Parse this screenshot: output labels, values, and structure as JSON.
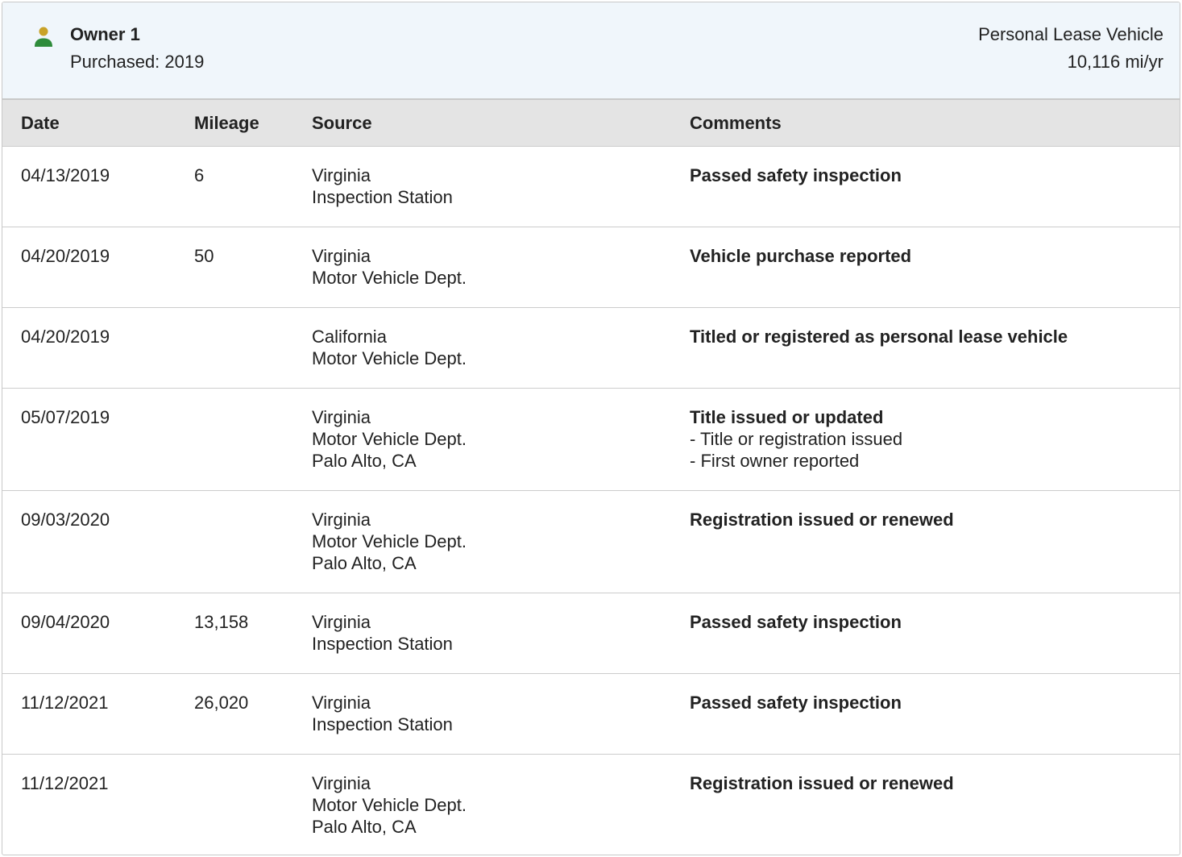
{
  "owner": {
    "name": "Owner 1",
    "purchased": "Purchased: 2019",
    "type": "Personal Lease Vehicle",
    "mileage": "10,116 mi/yr",
    "icon": "person-icon",
    "icon_head_color": "#c9a227",
    "icon_body_color": "#2e8b3a"
  },
  "table": {
    "headers": {
      "date": "Date",
      "mileage": "Mileage",
      "source": "Source",
      "comments": "Comments"
    },
    "rows": [
      {
        "date": "04/13/2019",
        "mileage": "6",
        "source": [
          "Virginia",
          "Inspection Station"
        ],
        "comment_title": "Passed safety inspection",
        "comment_details": []
      },
      {
        "date": "04/20/2019",
        "mileage": "50",
        "source": [
          "Virginia",
          "Motor Vehicle Dept."
        ],
        "comment_title": "Vehicle purchase reported",
        "comment_details": []
      },
      {
        "date": "04/20/2019",
        "mileage": "",
        "source": [
          "California",
          "Motor Vehicle Dept."
        ],
        "comment_title": "Titled or registered as personal lease vehicle",
        "comment_details": []
      },
      {
        "date": "05/07/2019",
        "mileage": "",
        "source": [
          "Virginia",
          "Motor Vehicle Dept.",
          "Palo Alto, CA"
        ],
        "comment_title": "Title issued or updated",
        "comment_details": [
          "- Title or registration issued",
          "- First owner reported"
        ]
      },
      {
        "date": "09/03/2020",
        "mileage": "",
        "source": [
          "Virginia",
          "Motor Vehicle Dept.",
          "Palo Alto, CA"
        ],
        "comment_title": "Registration issued or renewed",
        "comment_details": []
      },
      {
        "date": "09/04/2020",
        "mileage": "13,158",
        "source": [
          "Virginia",
          "Inspection Station"
        ],
        "comment_title": "Passed safety inspection",
        "comment_details": []
      },
      {
        "date": "11/12/2021",
        "mileage": "26,020",
        "source": [
          "Virginia",
          "Inspection Station"
        ],
        "comment_title": "Passed safety inspection",
        "comment_details": []
      },
      {
        "date": "11/12/2021",
        "mileage": "",
        "source": [
          "Virginia",
          "Motor Vehicle Dept.",
          "Palo Alto, CA"
        ],
        "comment_title": "Registration issued or renewed",
        "comment_details": []
      }
    ]
  }
}
